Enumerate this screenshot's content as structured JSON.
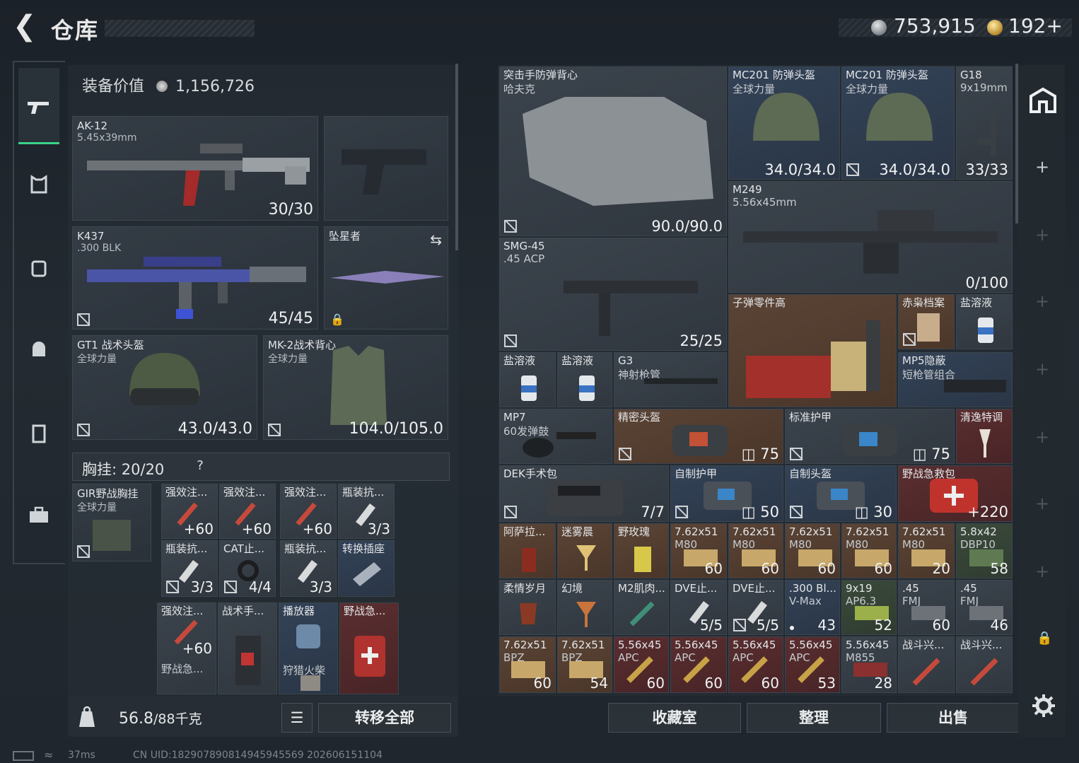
{
  "header": {
    "title": "仓库",
    "silver": "753,915",
    "gold": "192+"
  },
  "left": {
    "equip_value_label": "装备价值",
    "equip_value": "1,156,726",
    "primary": {
      "name": "AK-12",
      "caliber": "5.45x39mm",
      "count": "30/30"
    },
    "secondary": {
      "name": "K437",
      "caliber": ".300 BLK",
      "count": "45/45"
    },
    "melee": {
      "name": "坠星者"
    },
    "helmet": {
      "name": "GT1 战术头盔",
      "sub": "全球力量",
      "count": "43.0/43.0"
    },
    "armor": {
      "name": "MK-2战术背心",
      "sub": "全球力量",
      "count": "104.0/105.0"
    },
    "chest_label": "胸挂:",
    "chest_cap": "20/20",
    "chest_help": "?",
    "rig": {
      "name": "GIR野战胸挂",
      "sub": "全球力量"
    },
    "rig_items": [
      {
        "name": "强效注...",
        "count": "60"
      },
      {
        "name": "强效注...",
        "count": "60"
      },
      {
        "name": "强效注...",
        "count": "60"
      },
      {
        "name": "瓶装抗...",
        "count": "3/3"
      },
      {
        "name": "瓶装抗...",
        "count": "3/3"
      },
      {
        "name": "CAT止...",
        "count": "4/4"
      },
      {
        "name": "瓶装抗...",
        "count": "3/3"
      },
      {
        "name": "转换插座",
        "count": ""
      }
    ],
    "bag_items": [
      {
        "name": "强效注...",
        "sub": "野战急...",
        "count": "60"
      },
      {
        "name": "战术手...",
        "sub": "",
        "count": ""
      },
      {
        "name": "播放器",
        "sub": "狩猎火柴",
        "count": ""
      },
      {
        "name": "野战急...",
        "sub": "",
        "count": ""
      }
    ],
    "weight": "56.8",
    "weight_max": "/88千克",
    "transfer_all": "转移全部"
  },
  "stash": [
    {
      "name": "突击手防弹背心",
      "sub": "哈夫克",
      "count": "90.0/90.0"
    },
    {
      "name": "MC201 防弹头盔",
      "sub": "全球力量",
      "count": "34.0/34.0"
    },
    {
      "name": "MC201 防弹头盔",
      "sub": "全球力量",
      "count": "34.0/34.0"
    },
    {
      "name": "G18",
      "sub": "9x19mm",
      "count": "33/33"
    },
    {
      "name": "M249",
      "sub": "5.56x45mm",
      "count": "0/100"
    },
    {
      "name": "SMG-45",
      "sub": ".45 ACP",
      "count": "25/25"
    },
    {
      "name": "子弹零件高",
      "sub": "",
      "count": ""
    },
    {
      "name": "赤枭档案",
      "sub": "",
      "count": ""
    },
    {
      "name": "盐溶液",
      "sub": "",
      "count": ""
    },
    {
      "name": "盐溶液",
      "sub": "",
      "count": ""
    },
    {
      "name": "盐溶液",
      "sub": "",
      "count": ""
    },
    {
      "name": "G3",
      "sub": "神射枪管",
      "count": ""
    },
    {
      "name": "MP5隐蔽",
      "sub": "短枪管组合",
      "count": ""
    },
    {
      "name": "MP7",
      "sub": "60发弹鼓",
      "count": ""
    },
    {
      "name": "精密头盔",
      "sub": "",
      "count": "75"
    },
    {
      "name": "标准护甲",
      "sub": "",
      "count": "75"
    },
    {
      "name": "清逸特调",
      "sub": "",
      "count": ""
    },
    {
      "name": "DEK手术包",
      "sub": "",
      "count": "7/7"
    },
    {
      "name": "自制护甲",
      "sub": "",
      "count": "50"
    },
    {
      "name": "自制头盔",
      "sub": "",
      "count": "30"
    },
    {
      "name": "野战急救包",
      "sub": "",
      "count": "220"
    },
    {
      "name": "阿萨拉...",
      "sub": "",
      "count": ""
    },
    {
      "name": "迷雾晨",
      "sub": "",
      "count": ""
    },
    {
      "name": "野玫瑰",
      "sub": "",
      "count": ""
    },
    {
      "name": "7.62x51",
      "sub": "M80",
      "count": "60"
    },
    {
      "name": "7.62x51",
      "sub": "M80",
      "count": "60"
    },
    {
      "name": "7.62x51",
      "sub": "M80",
      "count": "60"
    },
    {
      "name": "7.62x51",
      "sub": "M80",
      "count": "60"
    },
    {
      "name": "7.62x51",
      "sub": "M80",
      "count": "20"
    },
    {
      "name": "5.8x42",
      "sub": "DBP10",
      "count": "58"
    },
    {
      "name": "柔情岁月",
      "sub": "",
      "count": ""
    },
    {
      "name": "幻境",
      "sub": "",
      "count": ""
    },
    {
      "name": "M2肌肉...",
      "sub": "",
      "count": ""
    },
    {
      "name": "DVE止...",
      "sub": "",
      "count": "5/5"
    },
    {
      "name": "DVE止...",
      "sub": "",
      "count": "5/5"
    },
    {
      "name": ".300 Bl...",
      "sub": "V-Max",
      "count": "43"
    },
    {
      "name": "9x19",
      "sub": "AP6.3",
      "count": "52"
    },
    {
      "name": ".45",
      "sub": "FMJ",
      "count": "60"
    },
    {
      "name": ".45",
      "sub": "FMJ",
      "count": "46"
    },
    {
      "name": "7.62x51",
      "sub": "BPZ",
      "count": "60"
    },
    {
      "name": "7.62x51",
      "sub": "BPZ",
      "count": "54"
    },
    {
      "name": "5.56x45",
      "sub": "APC",
      "count": "60"
    },
    {
      "name": "5.56x45",
      "sub": "APC",
      "count": "60"
    },
    {
      "name": "5.56x45",
      "sub": "APC",
      "count": "60"
    },
    {
      "name": "5.56x45",
      "sub": "APC",
      "count": "53"
    },
    {
      "name": "5.56x45",
      "sub": "M855",
      "count": "28"
    },
    {
      "name": "战斗兴...",
      "sub": "",
      "count": ""
    },
    {
      "name": "战斗兴...",
      "sub": "",
      "count": ""
    }
  ],
  "bottom_buttons": {
    "collect": "收藏室",
    "sort": "整理",
    "sell": "出售"
  },
  "footer": {
    "ping": "37ms",
    "uid": "CN UID:182907890814945945569 202606151104"
  },
  "colors": {
    "accent": "#3ad38a",
    "panel": "#2f3740",
    "rare_blue": "#334257",
    "brown": "#5a4436",
    "red": "#5a2e30"
  }
}
